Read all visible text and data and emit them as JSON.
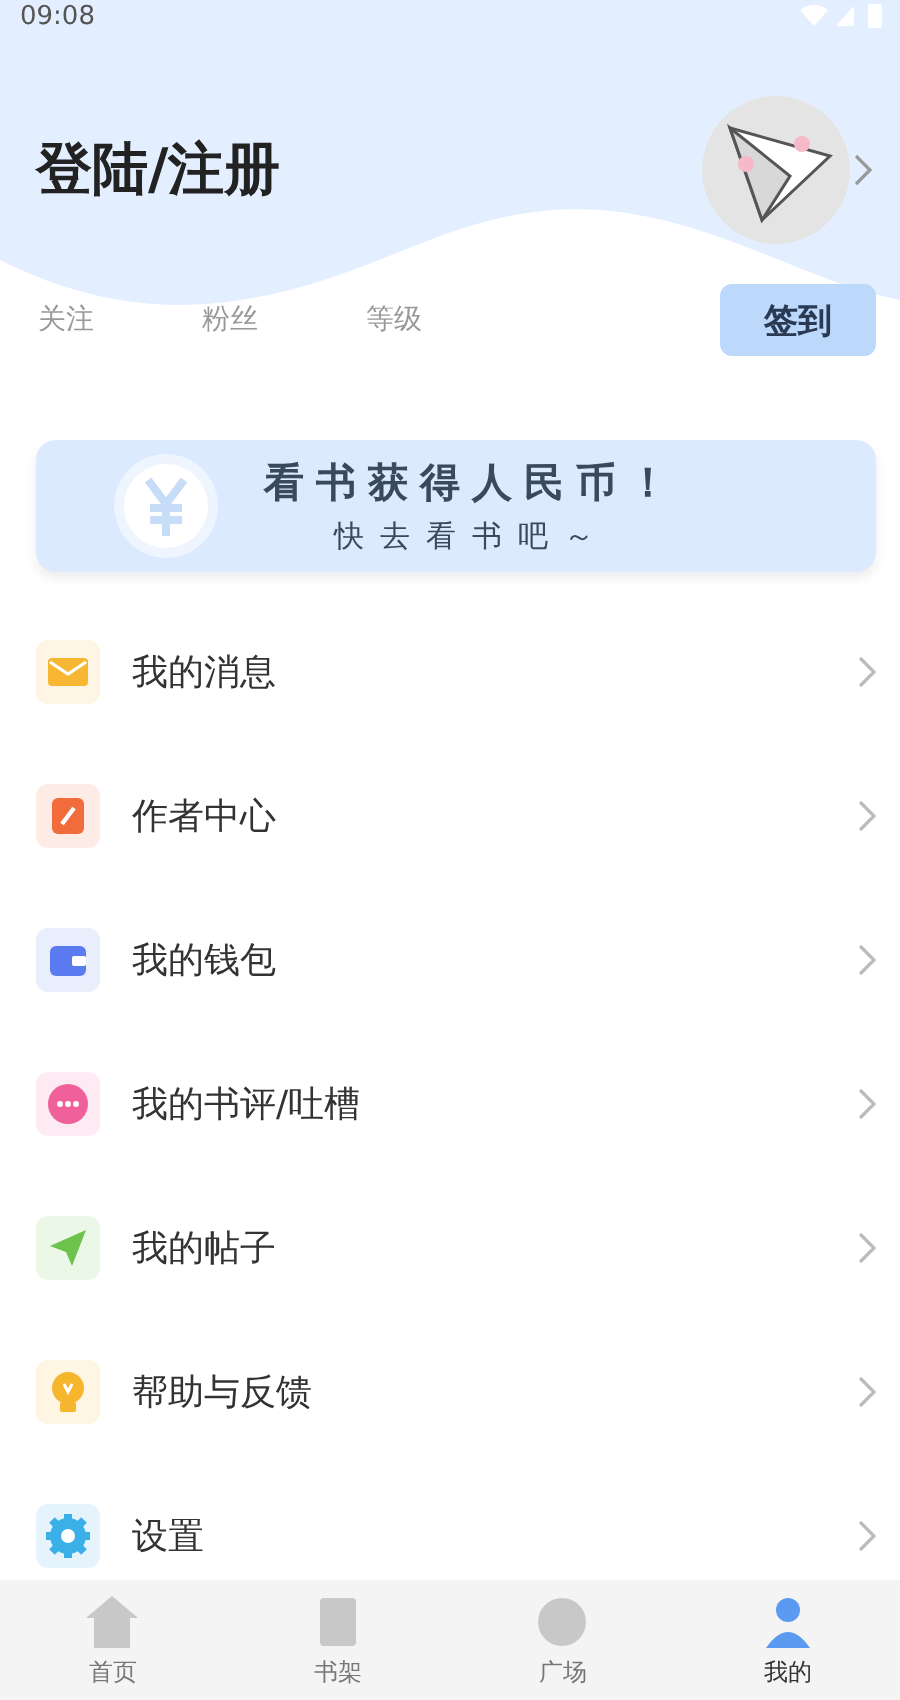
{
  "status_bar": {
    "time": "09:08"
  },
  "header": {
    "title": "登陆/注册"
  },
  "stats": [
    {
      "label": "关注"
    },
    {
      "label": "粉丝"
    },
    {
      "label": "等级"
    }
  ],
  "checkin_button": "签到",
  "banner": {
    "title": "看书获得人民币！",
    "subtitle": "快去看书吧～"
  },
  "menu": [
    {
      "label": "我的消息",
      "kind": "mail",
      "color": "#f7b733"
    },
    {
      "label": "作者中心",
      "kind": "pen",
      "color": "#f26b3a"
    },
    {
      "label": "我的钱包",
      "kind": "wallet",
      "color": "#5b7cf0"
    },
    {
      "label": "我的书评/吐槽",
      "kind": "chat",
      "color": "#f0609a"
    },
    {
      "label": "我的帖子",
      "kind": "plane",
      "color": "#6cc24a"
    },
    {
      "label": "帮助与反馈",
      "kind": "bulb",
      "color": "#f5b62e"
    },
    {
      "label": "设置",
      "kind": "gear",
      "color": "#3bb0e8"
    }
  ],
  "bottom_nav": [
    {
      "label": "首页",
      "kind": "home",
      "selected": false
    },
    {
      "label": "书架",
      "kind": "shelf",
      "selected": false
    },
    {
      "label": "广场",
      "kind": "square",
      "selected": false
    },
    {
      "label": "我的",
      "kind": "me",
      "selected": true
    }
  ]
}
